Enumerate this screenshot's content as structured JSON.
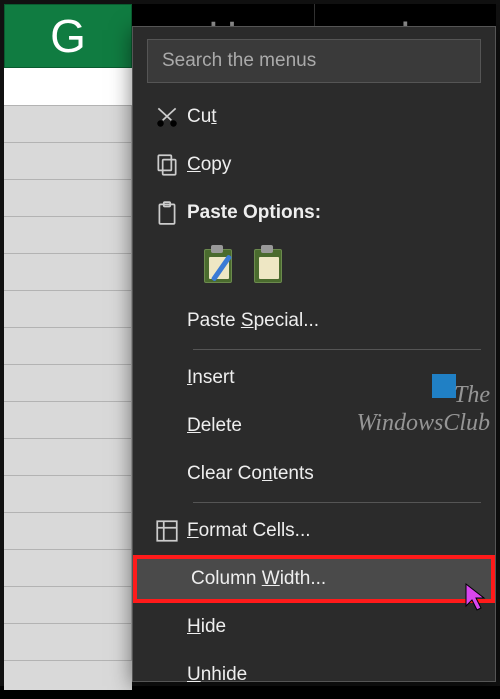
{
  "columns": {
    "selected": "G",
    "next1": "H",
    "next2": "I"
  },
  "menu": {
    "search_placeholder": "Search the menus",
    "cut": "Cut",
    "copy": "Copy",
    "paste_options": "Paste Options:",
    "paste_special": "Paste Special...",
    "insert": "Insert",
    "delete": "Delete",
    "clear_contents": "Clear Contents",
    "format_cells": "Format Cells...",
    "column_width": "Column Width...",
    "hide": "Hide",
    "unhide": "Unhide"
  },
  "watermark": {
    "line1": "The",
    "line2": "WindowsClub"
  }
}
